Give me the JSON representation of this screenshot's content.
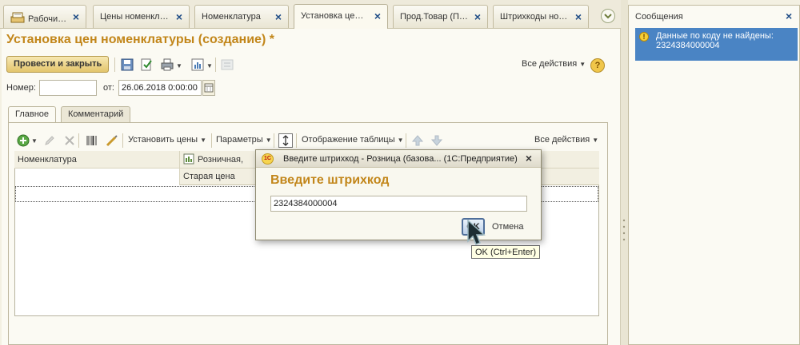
{
  "tabs": [
    {
      "label": "Рабочи…",
      "icon": "desktop-icon",
      "active": false
    },
    {
      "label": "Цены номенкл…",
      "active": false
    },
    {
      "label": "Номенклатура",
      "active": false
    },
    {
      "label": "Установка це…",
      "active": true
    },
    {
      "label": "Прод.Товар (П…",
      "active": false
    },
    {
      "label": "Штрихкоды но…",
      "active": false
    }
  ],
  "document": {
    "title": "Установка цен номенклатуры (создание) *",
    "toolbar": {
      "post_and_close": "Провести и закрыть",
      "all_actions": "Все действия"
    },
    "number_label": "Номер:",
    "number_value": "",
    "date_label": "от:",
    "date_value": "26.06.2018  0:00:00",
    "form_tabs": [
      "Главное",
      "Комментарий"
    ],
    "table_toolbar": {
      "set_prices": "Установить цены",
      "parameters": "Параметры",
      "table_display": "Отображение таблицы",
      "all_actions": "Все действия"
    },
    "grid": {
      "col_nomenclature": "Номенклатура",
      "col_retail": "Розничная,",
      "col_old_price": "Старая цена"
    }
  },
  "dialog": {
    "title": "Введите штрихкод - Розница (базова...  (1С:Предприятие)",
    "heading": "Введите штрихкод",
    "input_value": "2324384000004",
    "ok_label": "OK",
    "cancel_label": "Отмена",
    "tooltip": "OK (Ctrl+Enter)",
    "logo_text": "1С"
  },
  "messages": {
    "title": "Сообщения",
    "items": [
      {
        "text": "Данные по коду не найдены: 2324384000004"
      }
    ]
  },
  "colors": {
    "accent_title": "#c2861a",
    "selection": "#4a84c4",
    "tab_close": "#1e4c86"
  }
}
